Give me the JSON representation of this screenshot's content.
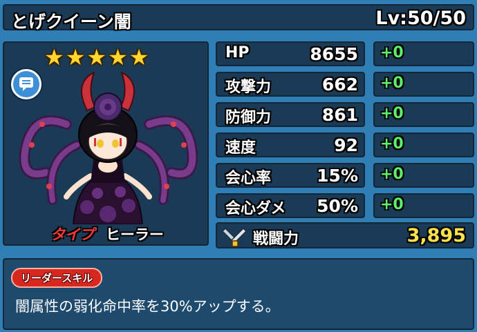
{
  "character": {
    "name": "とげクイーン闇",
    "level": "Lv:50/50",
    "stars": [
      "★",
      "★",
      "★",
      "★",
      "★"
    ],
    "type_label": "タイプ",
    "type_value": "ヒーラー"
  },
  "stats": [
    {
      "label": "HP",
      "value": "8655",
      "bonus": "+0"
    },
    {
      "label": "攻撃力",
      "value": "662",
      "bonus": "+0"
    },
    {
      "label": "防御力",
      "value": "861",
      "bonus": "+0"
    },
    {
      "label": "速度",
      "value": "92",
      "bonus": "+0"
    },
    {
      "label": "会心率",
      "value": "15%",
      "bonus": "+0"
    },
    {
      "label": "会心ダメ",
      "value": "50%",
      "bonus": "+0"
    }
  ],
  "power": {
    "label": "戦闘力",
    "value": "3,895",
    "icon": "swords-icon"
  },
  "skill": {
    "badge": "リーダースキル",
    "text": "闇属性の弱化命中率を30%アップする。"
  },
  "colors": {
    "background": "#2f7fb4",
    "panel": "#1a3a55",
    "bonus_green": "#5df06a",
    "power_yellow": "#ffe24a",
    "type_red": "#ff3a3a",
    "skill_badge": "#d8271e"
  }
}
